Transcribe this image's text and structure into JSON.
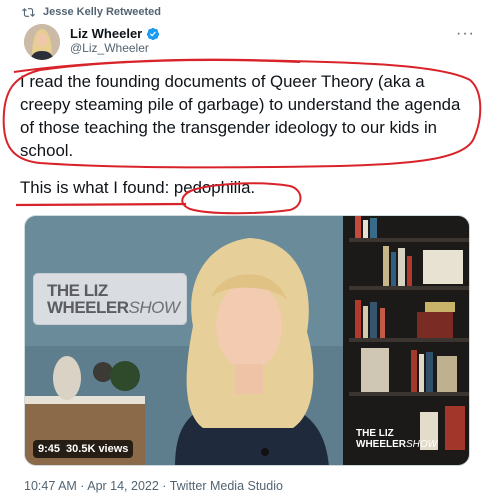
{
  "retweet_label": "Jesse Kelly Retweeted",
  "author": {
    "name": "Liz Wheeler",
    "handle": "@Liz_Wheeler"
  },
  "tweet": {
    "paragraph1": "I read the founding documents of Queer Theory (aka a creepy steaming pile of garbage) to understand the agenda of those teaching the transgender ideology to our kids in school.",
    "paragraph2_lead": "This is what I found: ",
    "paragraph2_highlight": "pedophilia."
  },
  "video": {
    "duration": "9:45",
    "views": "30.5K views",
    "logo_top": "THE LIZ",
    "logo_bottom_bold": "WHEELER",
    "logo_bottom_script": "SHOW",
    "corner_logo_top": "THE LIZ",
    "corner_logo_bold": "WHEELER",
    "corner_logo_script": "SHOW"
  },
  "timestamp": "10:47 AM · Apr 14, 2022 · Twitter Media Studio",
  "colors": {
    "annotation_red": "#d8232a",
    "verified_blue": "#1d9bf0",
    "secondary_text": "#536471"
  },
  "icons": {
    "retweet": "retweet-icon",
    "verified": "verified-badge-icon",
    "more": "more-options-icon"
  }
}
